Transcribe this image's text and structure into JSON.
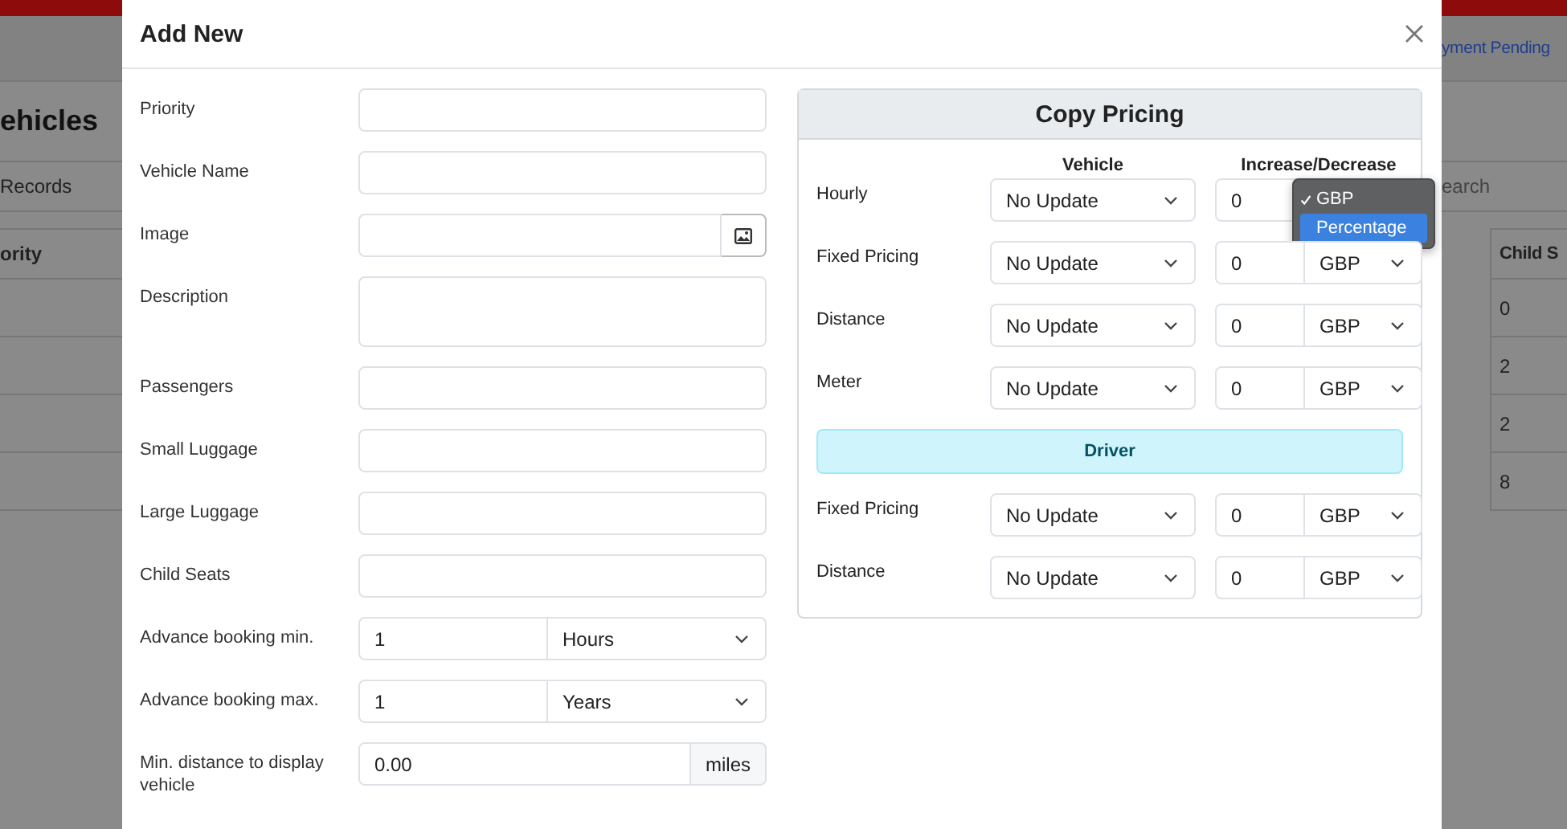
{
  "background": {
    "top_link": "yment Pending",
    "page_title": "ehicles",
    "records_label": "Records",
    "search_placeholder": "earch",
    "table": {
      "left_column": "ority",
      "right_column": "Child S",
      "right_values": [
        "0",
        "2",
        "2",
        "8"
      ]
    }
  },
  "modal": {
    "title": "Add New",
    "fields": [
      {
        "kind": "text",
        "label": "Priority"
      },
      {
        "kind": "text",
        "label": "Vehicle Name"
      },
      {
        "kind": "file",
        "label": "Image"
      },
      {
        "kind": "textarea",
        "label": "Description"
      },
      {
        "kind": "text",
        "label": "Passengers"
      },
      {
        "kind": "text",
        "label": "Small Luggage"
      },
      {
        "kind": "text",
        "label": "Large Luggage"
      },
      {
        "kind": "text",
        "label": "Child Seats"
      },
      {
        "kind": "unit_select",
        "label": "Advance booking min.",
        "value": "1",
        "unit": "Hours"
      },
      {
        "kind": "unit_select",
        "label": "Advance booking max.",
        "value": "1",
        "unit": "Years"
      },
      {
        "kind": "addon",
        "label": "Min. distance to display vehicle",
        "value": "0.00",
        "addon": "miles"
      }
    ],
    "pricing": {
      "title": "Copy Pricing",
      "vehicle_header": "Vehicle",
      "change_header": "Increase/Decrease",
      "vehicle_rows": [
        {
          "label": "Hourly",
          "option": "No Update",
          "amount": "0",
          "menu": [
            {
              "label": "GBP",
              "selected": true,
              "highlighted": false
            },
            {
              "label": "Percentage",
              "selected": false,
              "highlighted": true
            }
          ]
        },
        {
          "label": "Fixed Pricing",
          "option": "No Update",
          "amount": "0",
          "unit": "GBP"
        },
        {
          "label": "Distance",
          "option": "No Update",
          "amount": "0",
          "unit": "GBP"
        },
        {
          "label": "Meter",
          "option": "No Update",
          "amount": "0",
          "unit": "GBP"
        }
      ],
      "driver_title": "Driver",
      "driver_rows": [
        {
          "label": "Fixed Pricing",
          "option": "No Update",
          "amount": "0",
          "unit": "GBP"
        },
        {
          "label": "Distance",
          "option": "No Update",
          "amount": "0",
          "unit": "GBP"
        }
      ]
    }
  }
}
